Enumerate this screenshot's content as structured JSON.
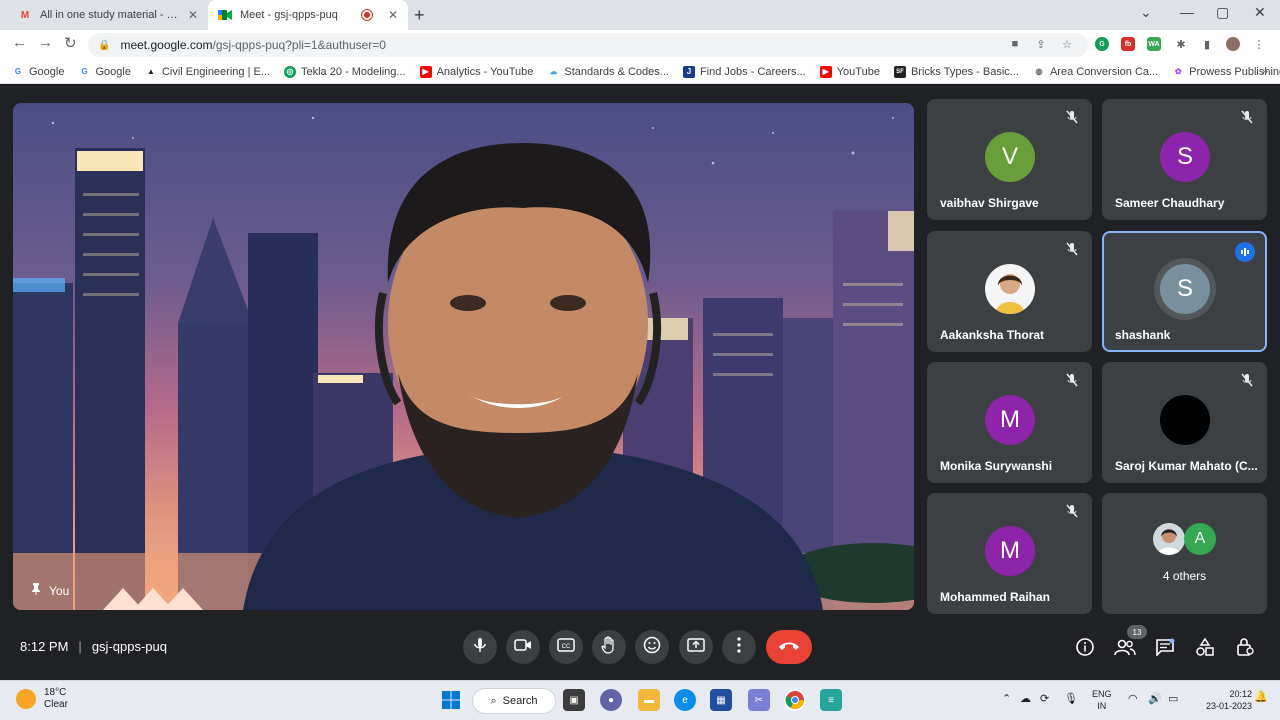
{
  "browser": {
    "tabs": [
      {
        "title": "All in one study material - akash",
        "favicon": "gmail-icon"
      },
      {
        "title": "Meet - gsj-qpps-puq",
        "favicon": "meet-icon",
        "recording": true
      }
    ],
    "url_host": "meet.google.com",
    "url_path": "/gsj-qpps-puq?pli=1&authuser=0",
    "bookmarks": [
      {
        "label": "Google",
        "icon": "google-icon"
      },
      {
        "label": "Google",
        "icon": "google-icon"
      },
      {
        "label": "Civil Engineering | E...",
        "icon": "bookmark-icon"
      },
      {
        "label": "Tekla 20 - Modeling...",
        "icon": "globe-icon"
      },
      {
        "label": "Analytics - YouTube",
        "icon": "youtube-icon"
      },
      {
        "label": "Standards & Codes...",
        "icon": "cloud-icon"
      },
      {
        "label": "Find Jobs - Careers...",
        "icon": "jobs-icon"
      },
      {
        "label": "YouTube",
        "icon": "youtube-icon"
      },
      {
        "label": "Bricks Types - Basic...",
        "icon": "sf-icon"
      },
      {
        "label": "Area Conversion Ca...",
        "icon": "globe-icon"
      },
      {
        "label": "Prowess Publishing",
        "icon": "prowess-icon"
      }
    ],
    "bookmarks_more": "»"
  },
  "meet": {
    "self_label": "You",
    "participants": [
      {
        "name": "vaibhav Shirgave",
        "initial": "V",
        "color": "#689f38",
        "muted": true
      },
      {
        "name": "Sameer Chaudhary",
        "initial": "S",
        "color": "#8e24aa",
        "muted": true
      },
      {
        "name": "Aakanksha Thorat",
        "initial": "",
        "color": "#f5f5f5",
        "muted": true,
        "photo": true
      },
      {
        "name": "shashank",
        "initial": "S",
        "color": "#78909c",
        "muted": false,
        "speaking": true
      },
      {
        "name": "Monika Surywanshi",
        "initial": "M",
        "color": "#8e24aa",
        "muted": true
      },
      {
        "name": "Saroj Kumar Mahato (C...",
        "initial": "",
        "color": "#000000",
        "muted": true
      },
      {
        "name": "Mohammed Raihan",
        "initial": "M",
        "color": "#8e24aa",
        "muted": true
      }
    ],
    "others": {
      "label": "4 others",
      "initial": "A",
      "color": "#34a853"
    },
    "time": "8:12 PM",
    "separator": "|",
    "meeting_code": "gsj-qpps-puq",
    "people_count": "13"
  },
  "taskbar": {
    "temperature": "18°C",
    "weather": "Clear",
    "search_label": "Search",
    "lang_1": "ENG",
    "lang_2": "IN",
    "time": "20:12",
    "date": "23-01-2023"
  }
}
